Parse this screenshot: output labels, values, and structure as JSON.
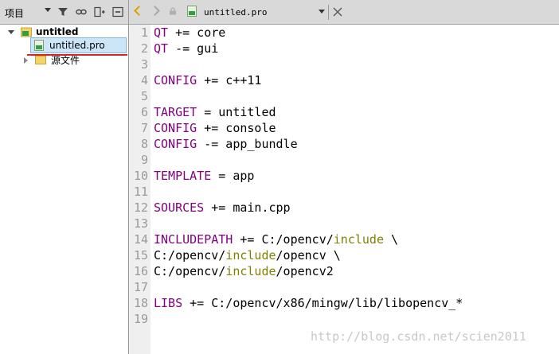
{
  "project_pane": {
    "title": "项目",
    "tree": {
      "project_name": "untitled",
      "selected_file": "untitled.pro",
      "folder_name": "源文件"
    }
  },
  "editor": {
    "file_title": "untitled.pro",
    "lines": [
      {
        "n": "1",
        "parts": [
          {
            "t": "QT",
            "c": "kw"
          },
          {
            "t": " += core",
            "c": ""
          }
        ]
      },
      {
        "n": "2",
        "parts": [
          {
            "t": "QT",
            "c": "kw"
          },
          {
            "t": " -= gui",
            "c": ""
          }
        ]
      },
      {
        "n": "3",
        "parts": []
      },
      {
        "n": "4",
        "parts": [
          {
            "t": "CONFIG",
            "c": "kw"
          },
          {
            "t": " += c++11",
            "c": ""
          }
        ]
      },
      {
        "n": "5",
        "parts": []
      },
      {
        "n": "6",
        "parts": [
          {
            "t": "TARGET",
            "c": "kw"
          },
          {
            "t": " = untitled",
            "c": ""
          }
        ]
      },
      {
        "n": "7",
        "parts": [
          {
            "t": "CONFIG",
            "c": "kw"
          },
          {
            "t": " += console",
            "c": ""
          }
        ]
      },
      {
        "n": "8",
        "parts": [
          {
            "t": "CONFIG",
            "c": "kw"
          },
          {
            "t": " -= app_bundle",
            "c": ""
          }
        ]
      },
      {
        "n": "9",
        "parts": []
      },
      {
        "n": "10",
        "parts": [
          {
            "t": "TEMPLATE",
            "c": "kw"
          },
          {
            "t": " = app",
            "c": ""
          }
        ]
      },
      {
        "n": "11",
        "parts": []
      },
      {
        "n": "12",
        "parts": [
          {
            "t": "SOURCES",
            "c": "kw"
          },
          {
            "t": " += main.cpp",
            "c": ""
          }
        ]
      },
      {
        "n": "13",
        "parts": []
      },
      {
        "n": "14",
        "parts": [
          {
            "t": "INCLUDEPATH",
            "c": "kw"
          },
          {
            "t": " += C:/opencv/",
            "c": ""
          },
          {
            "t": "include",
            "c": "inc"
          },
          {
            "t": " \\",
            "c": ""
          }
        ]
      },
      {
        "n": "15",
        "parts": [
          {
            "t": "C:/opencv/",
            "c": ""
          },
          {
            "t": "include",
            "c": "inc"
          },
          {
            "t": "/opencv \\",
            "c": ""
          }
        ]
      },
      {
        "n": "16",
        "parts": [
          {
            "t": "C:/opencv/",
            "c": ""
          },
          {
            "t": "include",
            "c": "inc"
          },
          {
            "t": "/opencv2",
            "c": ""
          }
        ]
      },
      {
        "n": "17",
        "parts": []
      },
      {
        "n": "18",
        "parts": [
          {
            "t": "LIBS",
            "c": "kw"
          },
          {
            "t": " += C:/opencv/x86/mingw/lib/libopencv_*",
            "c": ""
          }
        ]
      },
      {
        "n": "19",
        "parts": []
      }
    ]
  },
  "watermark": "http://blog.csdn.net/scien2011",
  "colors": {
    "keyword": "#800080",
    "include": "#808000",
    "accent": "#d7a400",
    "selection": "#cde6f7"
  }
}
